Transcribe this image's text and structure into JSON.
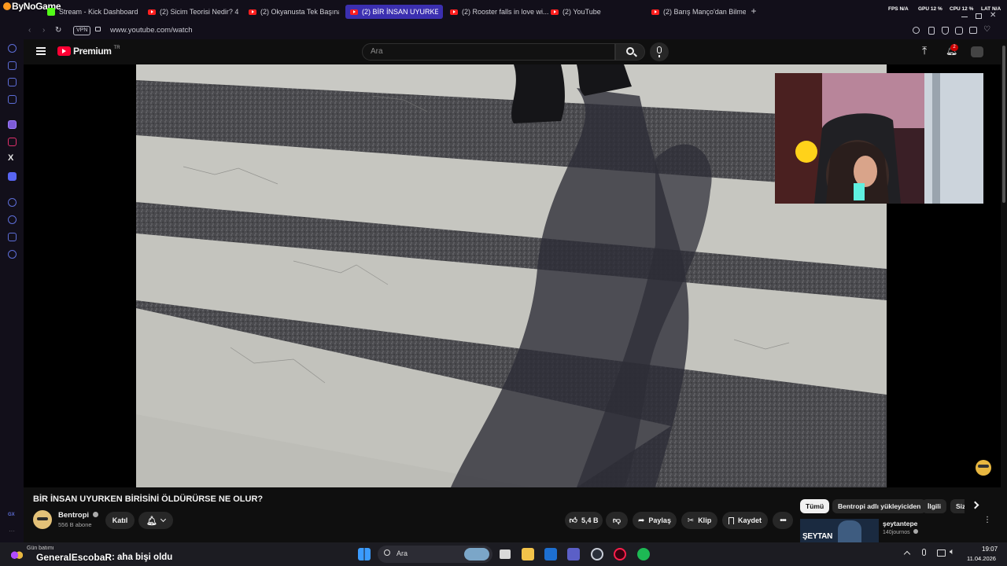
{
  "overlay": {
    "brand": "ByNoGame",
    "chat_small": "Gün batımı",
    "chat_user": "GeneralEscobaR",
    "chat_message": ": aha bişi oldu"
  },
  "browser": {
    "tabs": [
      {
        "label": "Stream - Kick Dashboard",
        "kind": "kick"
      },
      {
        "label": "(2) Sicim Teorisi Nedir? 4...",
        "kind": "yt"
      },
      {
        "label": "(2) Okyanusta Tek Başına...",
        "kind": "yt"
      },
      {
        "label": "(2) BİR İNSAN UYURKEN B...",
        "kind": "yt",
        "active": true
      },
      {
        "label": "(2) Rooster falls in love wi...",
        "kind": "yt"
      },
      {
        "label": "(2) YouTube",
        "kind": "yt"
      },
      {
        "label": "(2) Barış Manço'dan Bilme...",
        "kind": "yt"
      }
    ],
    "new_tab": "+",
    "vpn_badge": "VPN",
    "url": "www.youtube.com/watch",
    "stats": [
      {
        "label": "FPS",
        "value": "N/A"
      },
      {
        "label": "GPU",
        "value": "12 %"
      },
      {
        "label": "CPU",
        "value": "12 %"
      },
      {
        "label": "LAT",
        "value": "N/A"
      }
    ]
  },
  "youtube": {
    "logo_text": "Premium",
    "logo_region": "TR",
    "search_placeholder": "Ara",
    "notification_count": "2",
    "video_title": "BİR İNSAN UYURKEN BİRİSİNİ ÖLDÜRÜRSE NE OLUR?",
    "channel_name": "Bentropi",
    "subscribers": "556 B abone",
    "join_label": "Katıl",
    "likes": "5,4 B",
    "share_label": "Paylaş",
    "clip_label": "Klip",
    "save_label": "Kaydet",
    "chips": [
      "Tümü",
      "Bentropi adlı yükleyiciden",
      "İlgili",
      "Sizin için"
    ],
    "next_video": {
      "thumb_text": "ŞEYTAN",
      "title": "şeytantepe",
      "channel": "140journos"
    }
  },
  "taskbar": {
    "search_label": "Ara",
    "time": "19:07",
    "date": "11.04.2026"
  },
  "colors": {
    "yt_red": "#ff0033",
    "accent_tab": "#3b2fb0",
    "kick_green": "#53fc18",
    "spotify_green": "#1db954"
  }
}
